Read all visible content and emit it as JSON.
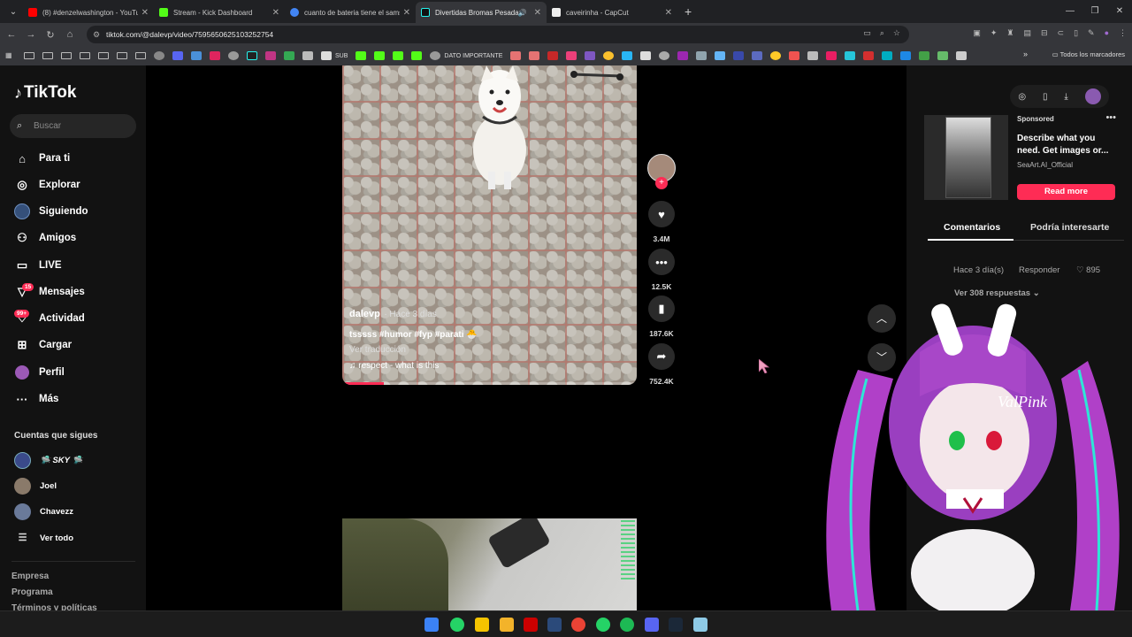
{
  "browser": {
    "tabs": [
      {
        "title": "(8) #denzelwashington - YouTube",
        "color": "#ff0000",
        "active": false
      },
      {
        "title": "Stream - Kick Dashboard",
        "color": "#53fc18",
        "active": false
      },
      {
        "title": "cuanto de bateria tiene el sams",
        "color": "#4285f4",
        "active": false
      },
      {
        "title": "Divertidas Bromas Pesadas",
        "color": "#111111",
        "active": true
      },
      {
        "title": "caveirinha - CapCut",
        "color": "#ffffff",
        "active": false
      }
    ],
    "url": "tiktok.com/@dalevp/video/7595650625103252754",
    "bookmark_labels": {
      "sub": "SUB",
      "dato": "DATO IMPORTANTE",
      "all": "Todos los marcadores"
    }
  },
  "sidebar": {
    "logo": "TikTok",
    "search_placeholder": "Buscar",
    "nav": [
      {
        "label": "Para ti",
        "icon": "home-icon"
      },
      {
        "label": "Explorar",
        "icon": "compass-icon"
      },
      {
        "label": "Siguiendo",
        "icon": "following-avatar-icon"
      },
      {
        "label": "Amigos",
        "icon": "friends-icon"
      },
      {
        "label": "LIVE",
        "icon": "live-icon"
      },
      {
        "label": "Mensajes",
        "icon": "messages-icon",
        "badge": "15"
      },
      {
        "label": "Actividad",
        "icon": "activity-icon",
        "badge": "99+"
      },
      {
        "label": "Cargar",
        "icon": "upload-icon"
      },
      {
        "label": "Perfil",
        "icon": "profile-icon"
      },
      {
        "label": "Más",
        "icon": "more-icon"
      }
    ],
    "following_title": "Cuentas que sigues",
    "following": [
      {
        "name": "🛸 SKY 🛸"
      },
      {
        "name": "Joel"
      },
      {
        "name": "Chavezz"
      }
    ],
    "see_all": "Ver todo",
    "footer": [
      "Empresa",
      "Programa",
      "Términos y políticas"
    ]
  },
  "video": {
    "username": "dalevp",
    "time": "· Hace 3 días",
    "caption": "tsssss #humor #fyp #parati 🐣",
    "translate": "Ver traducción",
    "sound": "respect - what is this",
    "progress": 0.14
  },
  "actions": {
    "likes": "3.4M",
    "comments": "12.5K",
    "saves": "187.6K",
    "shares": "752.4K"
  },
  "right_panel": {
    "sponsored": "Sponsored",
    "ad_text": "Describe what you need. Get images or...",
    "ad_account": "SeaArt.AI_Official",
    "cta": "Read more",
    "tabs": [
      "Comentarios",
      "Podría interesarte"
    ],
    "comment_time": "Hace 3 día(s)",
    "reply": "Responder",
    "comment_likes": "895",
    "view_replies": "Ver 308 respuestas"
  },
  "colors": {
    "accent": "#fe2c55",
    "bg": "#000000",
    "panel": "#121212"
  }
}
